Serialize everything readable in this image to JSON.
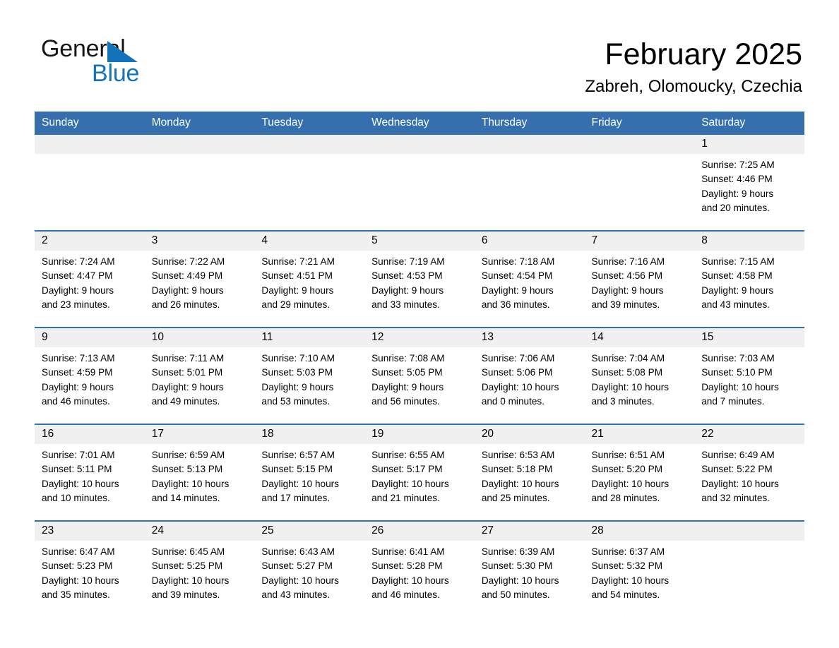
{
  "brand": {
    "name_part1": "General",
    "name_part2": "Blue",
    "accent_color": "#1273ba"
  },
  "header": {
    "month_title": "February 2025",
    "location": "Zabreh, Olomoucky, Czechia"
  },
  "theme": {
    "header_blue": "#356fae",
    "date_band_gray": "#f0f0f0"
  },
  "calendar": {
    "weekday_headers": [
      "Sunday",
      "Monday",
      "Tuesday",
      "Wednesday",
      "Thursday",
      "Friday",
      "Saturday"
    ],
    "weeks": [
      [
        {
          "day": "",
          "info": ""
        },
        {
          "day": "",
          "info": ""
        },
        {
          "day": "",
          "info": ""
        },
        {
          "day": "",
          "info": ""
        },
        {
          "day": "",
          "info": ""
        },
        {
          "day": "",
          "info": ""
        },
        {
          "day": "1",
          "info": "Sunrise: 7:25 AM\nSunset: 4:46 PM\nDaylight: 9 hours\nand 20 minutes."
        }
      ],
      [
        {
          "day": "2",
          "info": "Sunrise: 7:24 AM\nSunset: 4:47 PM\nDaylight: 9 hours\nand 23 minutes."
        },
        {
          "day": "3",
          "info": "Sunrise: 7:22 AM\nSunset: 4:49 PM\nDaylight: 9 hours\nand 26 minutes."
        },
        {
          "day": "4",
          "info": "Sunrise: 7:21 AM\nSunset: 4:51 PM\nDaylight: 9 hours\nand 29 minutes."
        },
        {
          "day": "5",
          "info": "Sunrise: 7:19 AM\nSunset: 4:53 PM\nDaylight: 9 hours\nand 33 minutes."
        },
        {
          "day": "6",
          "info": "Sunrise: 7:18 AM\nSunset: 4:54 PM\nDaylight: 9 hours\nand 36 minutes."
        },
        {
          "day": "7",
          "info": "Sunrise: 7:16 AM\nSunset: 4:56 PM\nDaylight: 9 hours\nand 39 minutes."
        },
        {
          "day": "8",
          "info": "Sunrise: 7:15 AM\nSunset: 4:58 PM\nDaylight: 9 hours\nand 43 minutes."
        }
      ],
      [
        {
          "day": "9",
          "info": "Sunrise: 7:13 AM\nSunset: 4:59 PM\nDaylight: 9 hours\nand 46 minutes."
        },
        {
          "day": "10",
          "info": "Sunrise: 7:11 AM\nSunset: 5:01 PM\nDaylight: 9 hours\nand 49 minutes."
        },
        {
          "day": "11",
          "info": "Sunrise: 7:10 AM\nSunset: 5:03 PM\nDaylight: 9 hours\nand 53 minutes."
        },
        {
          "day": "12",
          "info": "Sunrise: 7:08 AM\nSunset: 5:05 PM\nDaylight: 9 hours\nand 56 minutes."
        },
        {
          "day": "13",
          "info": "Sunrise: 7:06 AM\nSunset: 5:06 PM\nDaylight: 10 hours\nand 0 minutes."
        },
        {
          "day": "14",
          "info": "Sunrise: 7:04 AM\nSunset: 5:08 PM\nDaylight: 10 hours\nand 3 minutes."
        },
        {
          "day": "15",
          "info": "Sunrise: 7:03 AM\nSunset: 5:10 PM\nDaylight: 10 hours\nand 7 minutes."
        }
      ],
      [
        {
          "day": "16",
          "info": "Sunrise: 7:01 AM\nSunset: 5:11 PM\nDaylight: 10 hours\nand 10 minutes."
        },
        {
          "day": "17",
          "info": "Sunrise: 6:59 AM\nSunset: 5:13 PM\nDaylight: 10 hours\nand 14 minutes."
        },
        {
          "day": "18",
          "info": "Sunrise: 6:57 AM\nSunset: 5:15 PM\nDaylight: 10 hours\nand 17 minutes."
        },
        {
          "day": "19",
          "info": "Sunrise: 6:55 AM\nSunset: 5:17 PM\nDaylight: 10 hours\nand 21 minutes."
        },
        {
          "day": "20",
          "info": "Sunrise: 6:53 AM\nSunset: 5:18 PM\nDaylight: 10 hours\nand 25 minutes."
        },
        {
          "day": "21",
          "info": "Sunrise: 6:51 AM\nSunset: 5:20 PM\nDaylight: 10 hours\nand 28 minutes."
        },
        {
          "day": "22",
          "info": "Sunrise: 6:49 AM\nSunset: 5:22 PM\nDaylight: 10 hours\nand 32 minutes."
        }
      ],
      [
        {
          "day": "23",
          "info": "Sunrise: 6:47 AM\nSunset: 5:23 PM\nDaylight: 10 hours\nand 35 minutes."
        },
        {
          "day": "24",
          "info": "Sunrise: 6:45 AM\nSunset: 5:25 PM\nDaylight: 10 hours\nand 39 minutes."
        },
        {
          "day": "25",
          "info": "Sunrise: 6:43 AM\nSunset: 5:27 PM\nDaylight: 10 hours\nand 43 minutes."
        },
        {
          "day": "26",
          "info": "Sunrise: 6:41 AM\nSunset: 5:28 PM\nDaylight: 10 hours\nand 46 minutes."
        },
        {
          "day": "27",
          "info": "Sunrise: 6:39 AM\nSunset: 5:30 PM\nDaylight: 10 hours\nand 50 minutes."
        },
        {
          "day": "28",
          "info": "Sunrise: 6:37 AM\nSunset: 5:32 PM\nDaylight: 10 hours\nand 54 minutes."
        },
        {
          "day": "",
          "info": ""
        }
      ]
    ]
  }
}
